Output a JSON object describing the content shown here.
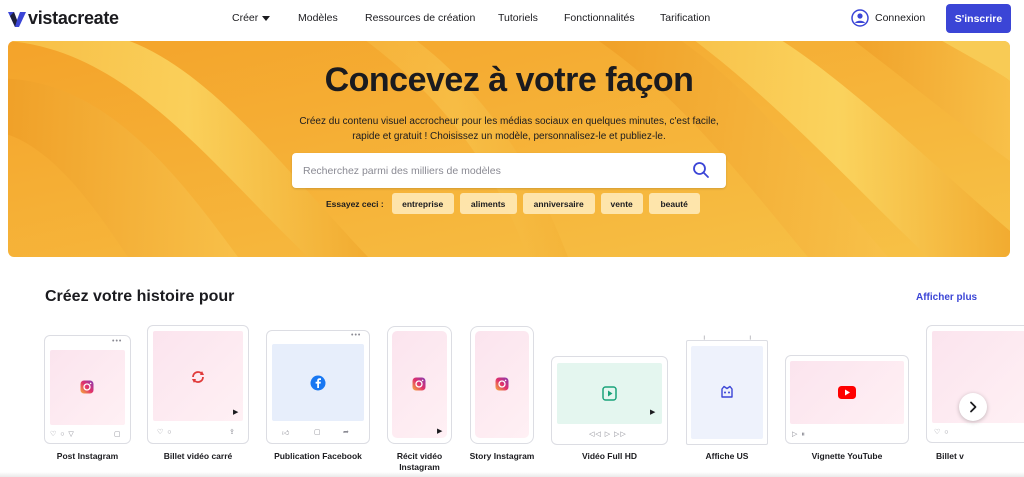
{
  "brand": {
    "name": "vistacreate",
    "accent": "#3b45d6"
  },
  "nav": {
    "items": [
      "Créer",
      "Modèles",
      "Ressources de création",
      "Tutoriels",
      "Fonctionnalités",
      "Tarification"
    ],
    "login": "Connexion",
    "signup": "S'inscrire"
  },
  "hero": {
    "title": "Concevez à votre façon",
    "subtitle_line1": "Créez du contenu visuel accrocheur pour les médias sociaux en quelques minutes, c'est facile,",
    "subtitle_line2": "rapide et gratuit ! Choisissez un modèle, personnalisez-le et publiez-le.",
    "search_placeholder": "Recherchez parmi des milliers de modèles",
    "try_label": "Essayez ceci :",
    "chips": [
      "entreprise",
      "aliments",
      "anniversaire",
      "vente",
      "beauté"
    ]
  },
  "section": {
    "title": "Créez votre histoire pour",
    "show_more": "Afficher plus",
    "cards": [
      {
        "label": "Post Instagram",
        "icon": "instagram-icon"
      },
      {
        "label": "Billet vidéo carré",
        "icon": "refresh-icon"
      },
      {
        "label": "Publication Facebook",
        "icon": "facebook-icon"
      },
      {
        "label_line1": "Récit vidéo",
        "label_line2": "Instagram",
        "icon": "instagram-icon"
      },
      {
        "label": "Story Instagram",
        "icon": "instagram-icon"
      },
      {
        "label": "Vidéo Full HD",
        "icon": "play-icon"
      },
      {
        "label": "Affiche US",
        "icon": "poster-icon"
      },
      {
        "label": "Vignette YouTube",
        "icon": "youtube-icon"
      },
      {
        "label": "Billet v",
        "icon": "card-icon"
      }
    ]
  }
}
